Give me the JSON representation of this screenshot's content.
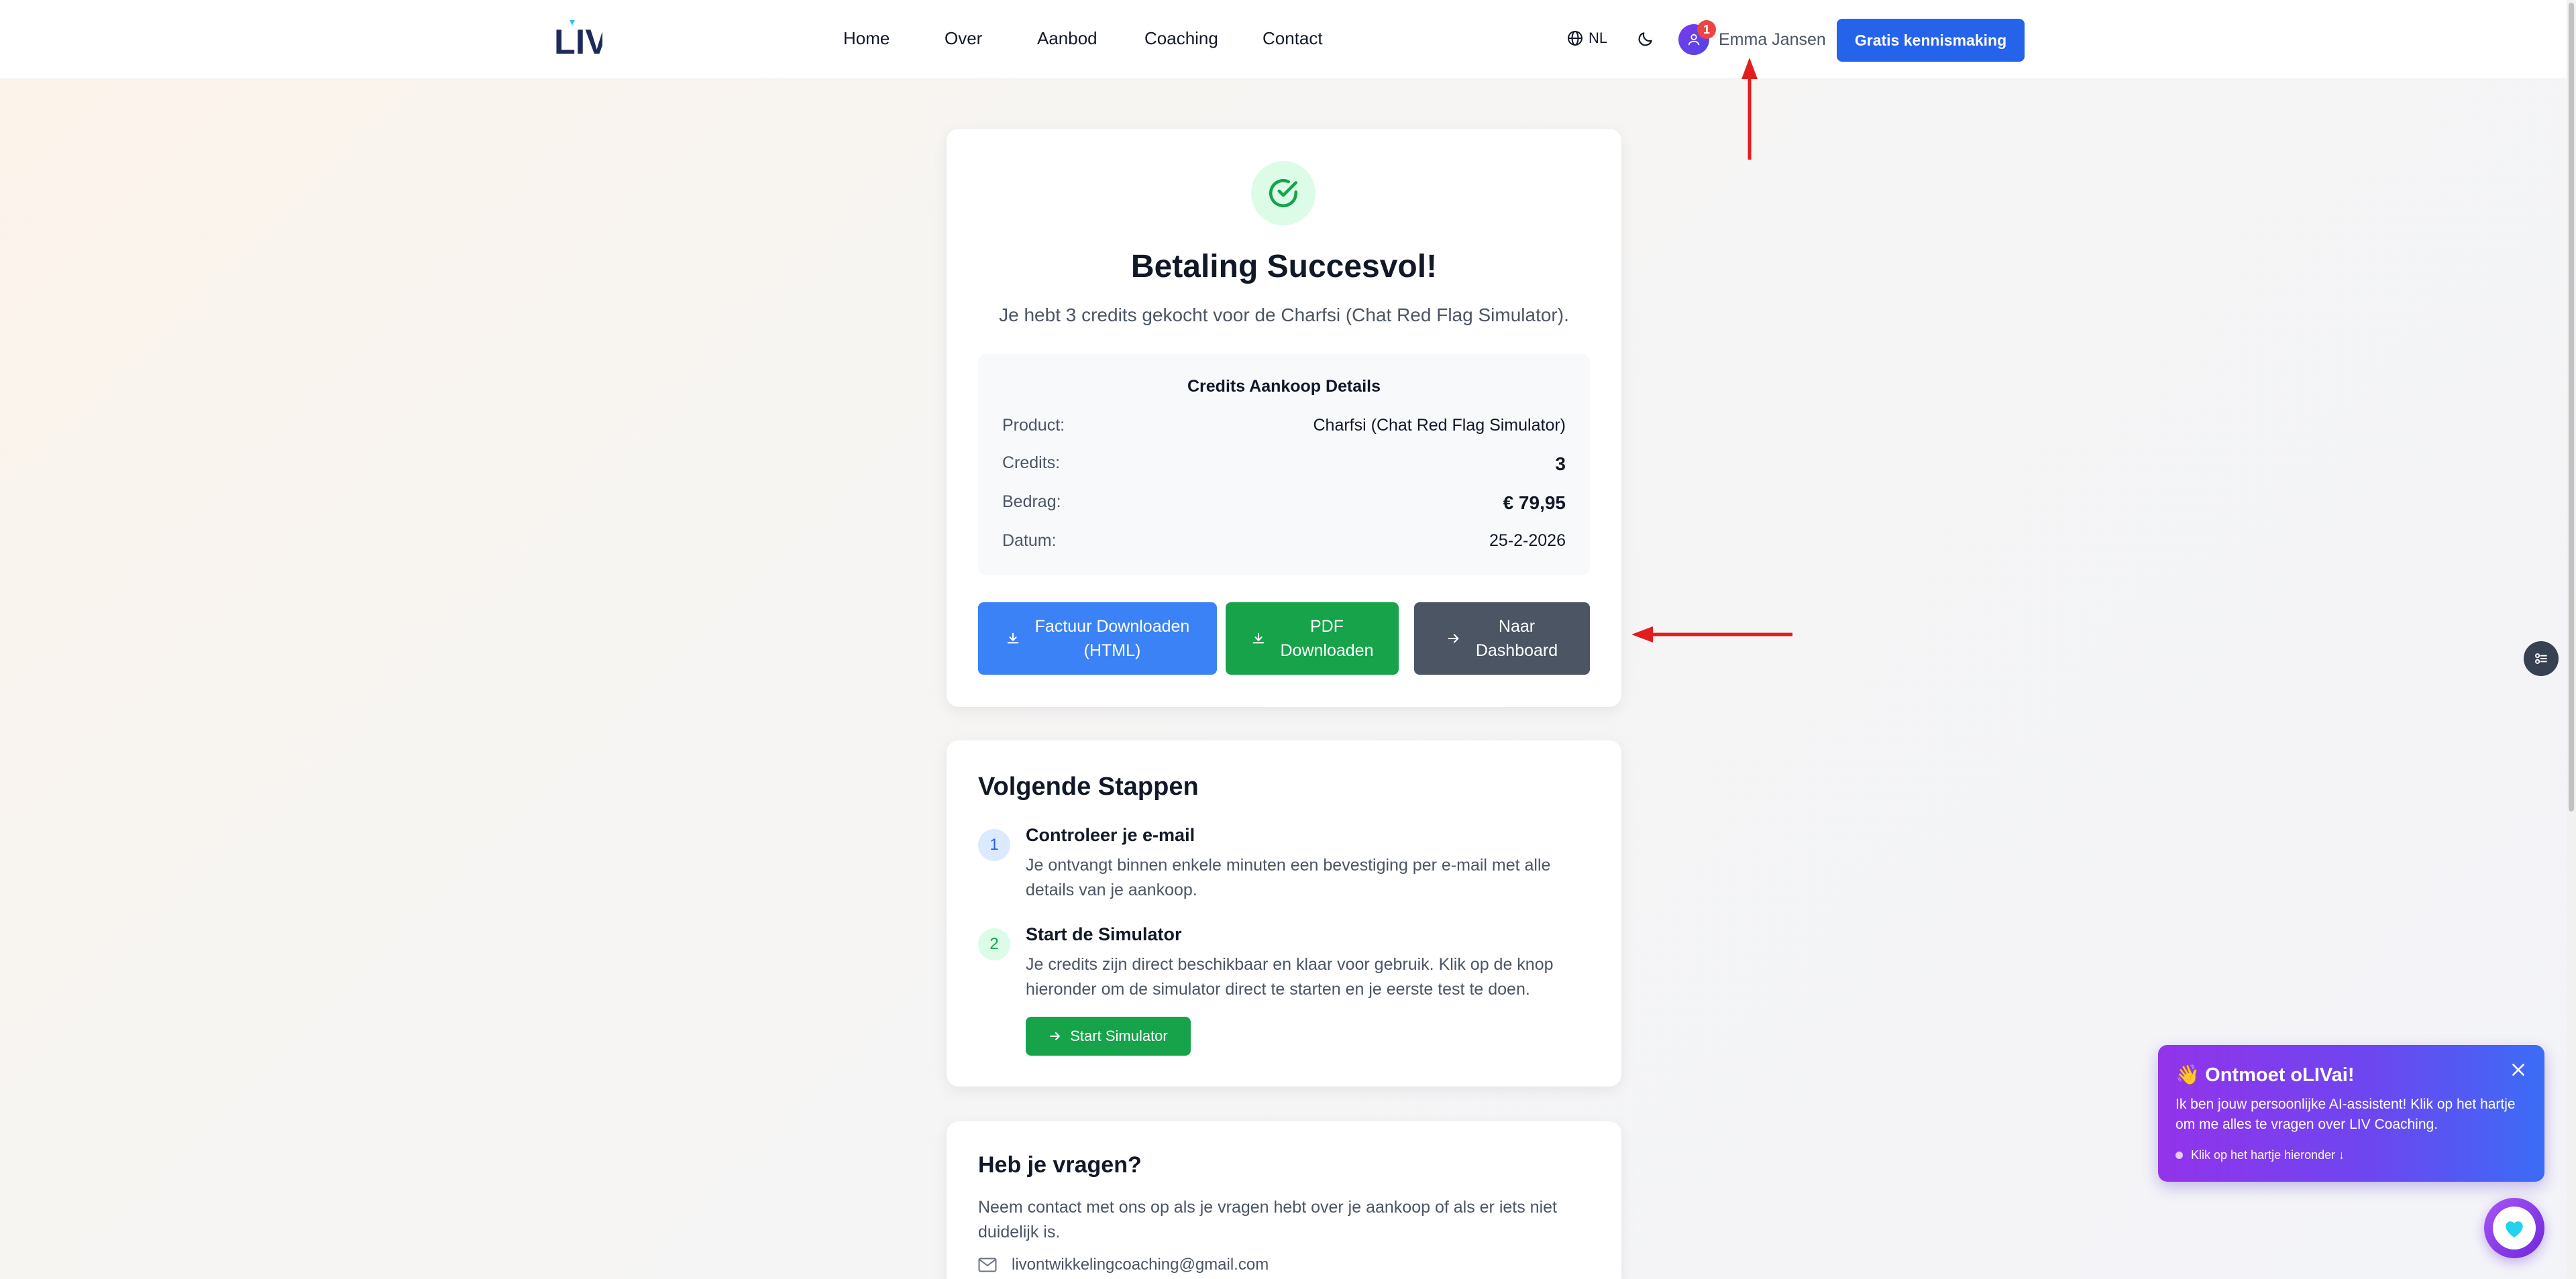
{
  "header": {
    "logo_text": "LIV",
    "nav": [
      "Home",
      "Over",
      "Aanbod",
      "Coaching",
      "Contact"
    ],
    "language": "NL",
    "notification_count": "1",
    "user_name": "Emma Jansen",
    "cta_label": "Gratis kennismaking"
  },
  "success": {
    "title": "Betaling Succesvol!",
    "subtitle": "Je hebt 3 credits gekocht voor de Charfsi (Chat Red Flag Simulator).",
    "details_title": "Credits Aankoop Details",
    "rows": [
      {
        "label": "Product:",
        "value": "Charfsi (Chat Red Flag Simulator)"
      },
      {
        "label": "Credits:",
        "value": "3"
      },
      {
        "label": "Bedrag:",
        "value": "€ 79,95"
      },
      {
        "label": "Datum:",
        "value": "25-2-2026"
      }
    ],
    "buttons": {
      "invoice_line1": "Factuur Downloaden",
      "invoice_line2": "(HTML)",
      "pdf_line1": "PDF",
      "pdf_line2": "Downloaden",
      "dashboard_line1": "Naar",
      "dashboard_line2": "Dashboard"
    }
  },
  "next_steps": {
    "title": "Volgende Stappen",
    "steps": [
      {
        "num": "1",
        "title": "Controleer je e-mail",
        "text": "Je ontvangt binnen enkele minuten een bevestiging per e-mail met alle details van je aankoop."
      },
      {
        "num": "2",
        "title": "Start de Simulator",
        "text": "Je credits zijn direct beschikbaar en klaar voor gebruik. Klik op de knop hieronder om de simulator direct te starten en je eerste test te doen."
      }
    ],
    "start_button": "Start Simulator"
  },
  "questions": {
    "title": "Heb je vragen?",
    "text": "Neem contact met ons op als je vragen hebt over je aankoop of als er iets niet duidelijk is.",
    "email": "livontwikkelingcoaching@gmail.com"
  },
  "chat_popup": {
    "title": "👋 Ontmoet oLIVai!",
    "body": "Ik ben jouw persoonlijke AI-assistent! Klik op het hartje om me alles te vragen over LIV Coaching.",
    "hint": "Klik op het hartje hieronder ↓"
  },
  "colors": {
    "primary_blue": "#2563eb",
    "green": "#16a34a",
    "gray_button": "#4b5563",
    "annotation_red": "#e11d1d"
  }
}
